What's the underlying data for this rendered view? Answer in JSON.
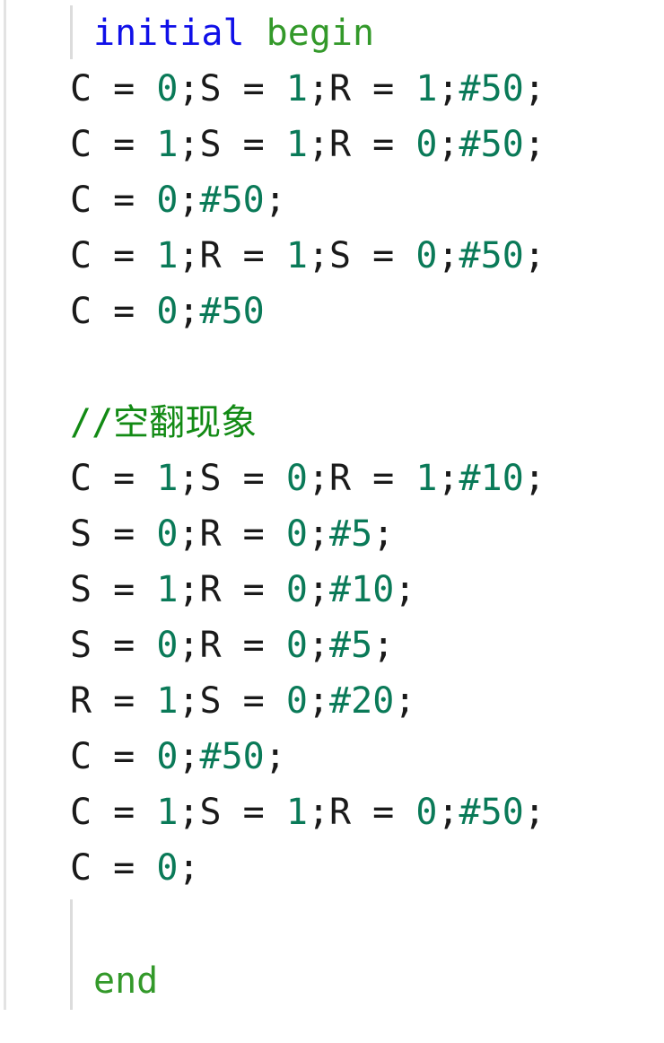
{
  "keywords": {
    "initial": "initial",
    "begin": "begin",
    "end": "end"
  },
  "comment": "//空翻现象",
  "lines": [
    [
      "C = ",
      "0",
      ";S = ",
      "1",
      ";R = ",
      "1",
      ";",
      "#50",
      ";"
    ],
    [
      "C = ",
      "1",
      ";S = ",
      "1",
      ";R = ",
      "0",
      ";",
      "#50",
      ";"
    ],
    [
      "C = ",
      "0",
      ";",
      "#50",
      ";"
    ],
    [
      "C = ",
      "1",
      ";R = ",
      "1",
      ";S = ",
      "0",
      ";",
      "#50",
      ";"
    ],
    [
      "C = ",
      "0",
      ";",
      "#50"
    ],
    [
      "C = ",
      "1",
      ";S = ",
      "0",
      ";R = ",
      "1",
      ";",
      "#10",
      ";"
    ],
    [
      "S = ",
      "0",
      ";R = ",
      "0",
      ";",
      "#5",
      ";"
    ],
    [
      "S = ",
      "1",
      ";R = ",
      "0",
      ";",
      "#10",
      ";"
    ],
    [
      "S = ",
      "0",
      ";R = ",
      "0",
      ";",
      "#5",
      ";"
    ],
    [
      "R = ",
      "1",
      ";S = ",
      "0",
      ";",
      "#20",
      ";"
    ],
    [
      "C = ",
      "0",
      ";",
      "#50",
      ";"
    ],
    [
      "C = ",
      "1",
      ";S = ",
      "1",
      ";R = ",
      "0",
      ";",
      "#50",
      ";"
    ],
    [
      "C = ",
      "0",
      ";"
    ]
  ],
  "colors": {
    "keyword_initial": "#1010e8",
    "keyword_begin_end": "#33992a",
    "number": "#0a7a58",
    "comment": "#128a14",
    "text": "#1a1a1a"
  }
}
